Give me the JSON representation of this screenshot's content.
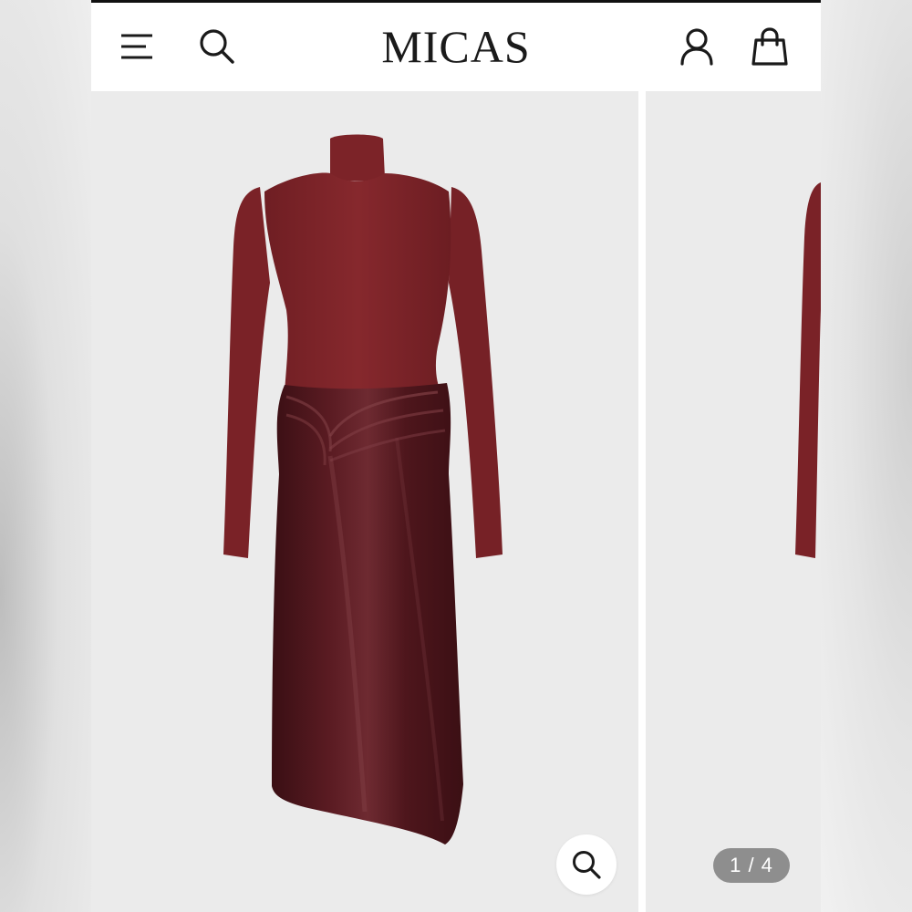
{
  "header": {
    "brand": "MICAS",
    "icons": [
      "menu-icon",
      "search-icon",
      "account-icon",
      "bag-icon"
    ]
  },
  "gallery": {
    "pager_text": "1 / 4",
    "current": 1,
    "total": 4,
    "zoom_icon": "search-icon"
  },
  "colors": {
    "top": "#7f2327",
    "skirt": "#4a1419",
    "slide_background": "#ebebeb",
    "pager_background": "#8e8e8e"
  }
}
